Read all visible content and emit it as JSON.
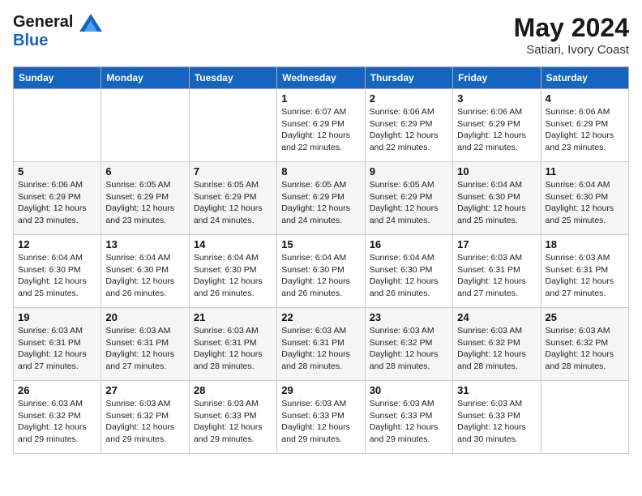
{
  "header": {
    "logo_line1": "General",
    "logo_line2": "Blue",
    "month_year": "May 2024",
    "location": "Satiari, Ivory Coast"
  },
  "days_of_week": [
    "Sunday",
    "Monday",
    "Tuesday",
    "Wednesday",
    "Thursday",
    "Friday",
    "Saturday"
  ],
  "weeks": [
    [
      {
        "day": "",
        "sunrise": "",
        "sunset": "",
        "daylight": ""
      },
      {
        "day": "",
        "sunrise": "",
        "sunset": "",
        "daylight": ""
      },
      {
        "day": "",
        "sunrise": "",
        "sunset": "",
        "daylight": ""
      },
      {
        "day": "1",
        "sunrise": "Sunrise: 6:07 AM",
        "sunset": "Sunset: 6:29 PM",
        "daylight": "Daylight: 12 hours and 22 minutes."
      },
      {
        "day": "2",
        "sunrise": "Sunrise: 6:06 AM",
        "sunset": "Sunset: 6:29 PM",
        "daylight": "Daylight: 12 hours and 22 minutes."
      },
      {
        "day": "3",
        "sunrise": "Sunrise: 6:06 AM",
        "sunset": "Sunset: 6:29 PM",
        "daylight": "Daylight: 12 hours and 22 minutes."
      },
      {
        "day": "4",
        "sunrise": "Sunrise: 6:06 AM",
        "sunset": "Sunset: 6:29 PM",
        "daylight": "Daylight: 12 hours and 23 minutes."
      }
    ],
    [
      {
        "day": "5",
        "sunrise": "Sunrise: 6:06 AM",
        "sunset": "Sunset: 6:29 PM",
        "daylight": "Daylight: 12 hours and 23 minutes."
      },
      {
        "day": "6",
        "sunrise": "Sunrise: 6:05 AM",
        "sunset": "Sunset: 6:29 PM",
        "daylight": "Daylight: 12 hours and 23 minutes."
      },
      {
        "day": "7",
        "sunrise": "Sunrise: 6:05 AM",
        "sunset": "Sunset: 6:29 PM",
        "daylight": "Daylight: 12 hours and 24 minutes."
      },
      {
        "day": "8",
        "sunrise": "Sunrise: 6:05 AM",
        "sunset": "Sunset: 6:29 PM",
        "daylight": "Daylight: 12 hours and 24 minutes."
      },
      {
        "day": "9",
        "sunrise": "Sunrise: 6:05 AM",
        "sunset": "Sunset: 6:29 PM",
        "daylight": "Daylight: 12 hours and 24 minutes."
      },
      {
        "day": "10",
        "sunrise": "Sunrise: 6:04 AM",
        "sunset": "Sunset: 6:30 PM",
        "daylight": "Daylight: 12 hours and 25 minutes."
      },
      {
        "day": "11",
        "sunrise": "Sunrise: 6:04 AM",
        "sunset": "Sunset: 6:30 PM",
        "daylight": "Daylight: 12 hours and 25 minutes."
      }
    ],
    [
      {
        "day": "12",
        "sunrise": "Sunrise: 6:04 AM",
        "sunset": "Sunset: 6:30 PM",
        "daylight": "Daylight: 12 hours and 25 minutes."
      },
      {
        "day": "13",
        "sunrise": "Sunrise: 6:04 AM",
        "sunset": "Sunset: 6:30 PM",
        "daylight": "Daylight: 12 hours and 26 minutes."
      },
      {
        "day": "14",
        "sunrise": "Sunrise: 6:04 AM",
        "sunset": "Sunset: 6:30 PM",
        "daylight": "Daylight: 12 hours and 26 minutes."
      },
      {
        "day": "15",
        "sunrise": "Sunrise: 6:04 AM",
        "sunset": "Sunset: 6:30 PM",
        "daylight": "Daylight: 12 hours and 26 minutes."
      },
      {
        "day": "16",
        "sunrise": "Sunrise: 6:04 AM",
        "sunset": "Sunset: 6:30 PM",
        "daylight": "Daylight: 12 hours and 26 minutes."
      },
      {
        "day": "17",
        "sunrise": "Sunrise: 6:03 AM",
        "sunset": "Sunset: 6:31 PM",
        "daylight": "Daylight: 12 hours and 27 minutes."
      },
      {
        "day": "18",
        "sunrise": "Sunrise: 6:03 AM",
        "sunset": "Sunset: 6:31 PM",
        "daylight": "Daylight: 12 hours and 27 minutes."
      }
    ],
    [
      {
        "day": "19",
        "sunrise": "Sunrise: 6:03 AM",
        "sunset": "Sunset: 6:31 PM",
        "daylight": "Daylight: 12 hours and 27 minutes."
      },
      {
        "day": "20",
        "sunrise": "Sunrise: 6:03 AM",
        "sunset": "Sunset: 6:31 PM",
        "daylight": "Daylight: 12 hours and 27 minutes."
      },
      {
        "day": "21",
        "sunrise": "Sunrise: 6:03 AM",
        "sunset": "Sunset: 6:31 PM",
        "daylight": "Daylight: 12 hours and 28 minutes."
      },
      {
        "day": "22",
        "sunrise": "Sunrise: 6:03 AM",
        "sunset": "Sunset: 6:31 PM",
        "daylight": "Daylight: 12 hours and 28 minutes."
      },
      {
        "day": "23",
        "sunrise": "Sunrise: 6:03 AM",
        "sunset": "Sunset: 6:32 PM",
        "daylight": "Daylight: 12 hours and 28 minutes."
      },
      {
        "day": "24",
        "sunrise": "Sunrise: 6:03 AM",
        "sunset": "Sunset: 6:32 PM",
        "daylight": "Daylight: 12 hours and 28 minutes."
      },
      {
        "day": "25",
        "sunrise": "Sunrise: 6:03 AM",
        "sunset": "Sunset: 6:32 PM",
        "daylight": "Daylight: 12 hours and 28 minutes."
      }
    ],
    [
      {
        "day": "26",
        "sunrise": "Sunrise: 6:03 AM",
        "sunset": "Sunset: 6:32 PM",
        "daylight": "Daylight: 12 hours and 29 minutes."
      },
      {
        "day": "27",
        "sunrise": "Sunrise: 6:03 AM",
        "sunset": "Sunset: 6:32 PM",
        "daylight": "Daylight: 12 hours and 29 minutes."
      },
      {
        "day": "28",
        "sunrise": "Sunrise: 6:03 AM",
        "sunset": "Sunset: 6:33 PM",
        "daylight": "Daylight: 12 hours and 29 minutes."
      },
      {
        "day": "29",
        "sunrise": "Sunrise: 6:03 AM",
        "sunset": "Sunset: 6:33 PM",
        "daylight": "Daylight: 12 hours and 29 minutes."
      },
      {
        "day": "30",
        "sunrise": "Sunrise: 6:03 AM",
        "sunset": "Sunset: 6:33 PM",
        "daylight": "Daylight: 12 hours and 29 minutes."
      },
      {
        "day": "31",
        "sunrise": "Sunrise: 6:03 AM",
        "sunset": "Sunset: 6:33 PM",
        "daylight": "Daylight: 12 hours and 30 minutes."
      },
      {
        "day": "",
        "sunrise": "",
        "sunset": "",
        "daylight": ""
      }
    ]
  ]
}
